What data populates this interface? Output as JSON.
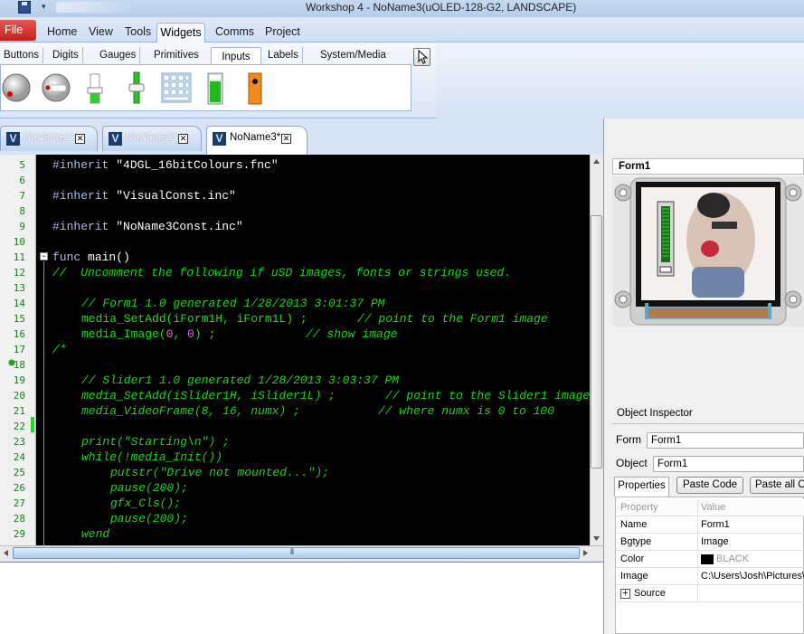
{
  "window": {
    "title": "Workshop 4 - NoName3(uOLED-128-G2, LANDSCAPE)"
  },
  "menu": {
    "file": "File",
    "tabs": [
      "Home",
      "View",
      "Tools",
      "Widgets",
      "Comms",
      "Project"
    ],
    "active": "Widgets"
  },
  "widget_tabs": {
    "tabs": [
      "Buttons",
      "Digits",
      "Gauges",
      "Primitives",
      "Inputs",
      "Labels",
      "System/Media"
    ],
    "active": "Inputs",
    "icons": [
      "knob-icon",
      "knob-flat-icon",
      "slider-icon",
      "trackbar-icon",
      "keyboard-icon",
      "meter-icon",
      "switch-icon"
    ]
  },
  "documents": {
    "tabs": [
      "NoName1*",
      "NoName2*",
      "NoName3*"
    ],
    "active": "NoName3*"
  },
  "editor": {
    "line_numbers": [
      "5",
      "6",
      "7",
      "8",
      "9",
      "10",
      "11",
      "12",
      "13",
      "14",
      "15",
      "16",
      "17",
      "18",
      "19",
      "20",
      "21",
      "22",
      "23",
      "24",
      "25",
      "26",
      "27",
      "28",
      "29"
    ],
    "lines": {
      "l5": {
        "a": "#inherit",
        "b": " \"4DGL_16bitColours.fnc\""
      },
      "l7": {
        "a": "#inherit",
        "b": " \"VisualConst.inc\""
      },
      "l9": {
        "a": "#inherit",
        "b": " \"NoName3Const.inc\""
      },
      "l11": {
        "a": "func",
        "b": " main()"
      },
      "l12": "//  Uncomment the following if uSD images, fonts or strings used.",
      "l14": "// Form1 1.0 generated 1/28/2013 3:01:37 PM",
      "l15": {
        "a": "media_SetAdd(iForm1H, iForm1L) ;",
        "c": "// point to the Form1 image"
      },
      "l16": {
        "a": "media_Image(",
        "n1": "0",
        "s": ", ",
        "n2": "0",
        "b": ") ;",
        "c": "// show image"
      },
      "l17": "/*",
      "l19": "// Slider1 1.0 generated 1/28/2013 3:03:37 PM",
      "l20": {
        "a": "media_SetAdd(iSlider1H, iSlider1L) ;",
        "c": "// point to the Slider1 image"
      },
      "l21": {
        "a": "media_VideoFrame(8, 16, numx) ;",
        "c": "// where numx is 0 to 100"
      },
      "l23": "print(\"Starting\\n\") ;",
      "l24": "while(!media_Init())",
      "l25": "putstr(\"Drive not mounted...\");",
      "l26": "pause(200);",
      "l27": "gfx_Cls();",
      "l28": "pause(200);",
      "l29": "wend"
    },
    "fold_symbol": "−",
    "hscroll_grip": "⦀"
  },
  "form_preview": {
    "title": "Form1"
  },
  "object_inspector": {
    "title": "Object Inspector",
    "form_label": "Form",
    "form_value": "Form1",
    "object_label": "Object",
    "object_value": "Form1",
    "tabs": [
      "Properties",
      "Paste Code",
      "Paste all Co"
    ],
    "columns": [
      "Property",
      "Value"
    ],
    "rows": [
      {
        "name": "Name",
        "value": "Form1"
      },
      {
        "name": "Bgtype",
        "value": "Image"
      },
      {
        "name": "Color",
        "value": "BLACK",
        "swatch": "#000000"
      },
      {
        "name": "Image",
        "value": "C:\\Users\\Josh\\Pictures\\"
      },
      {
        "name": "Source",
        "value": ""
      }
    ],
    "expand_symbol": "+"
  },
  "colors": {
    "editor_bg": "#000000",
    "comment": "#18d818",
    "keyword": "#aeb6ff",
    "number": "#d56cd5",
    "file_button": "#c0221b",
    "ribbon": "#d6e4f5"
  }
}
